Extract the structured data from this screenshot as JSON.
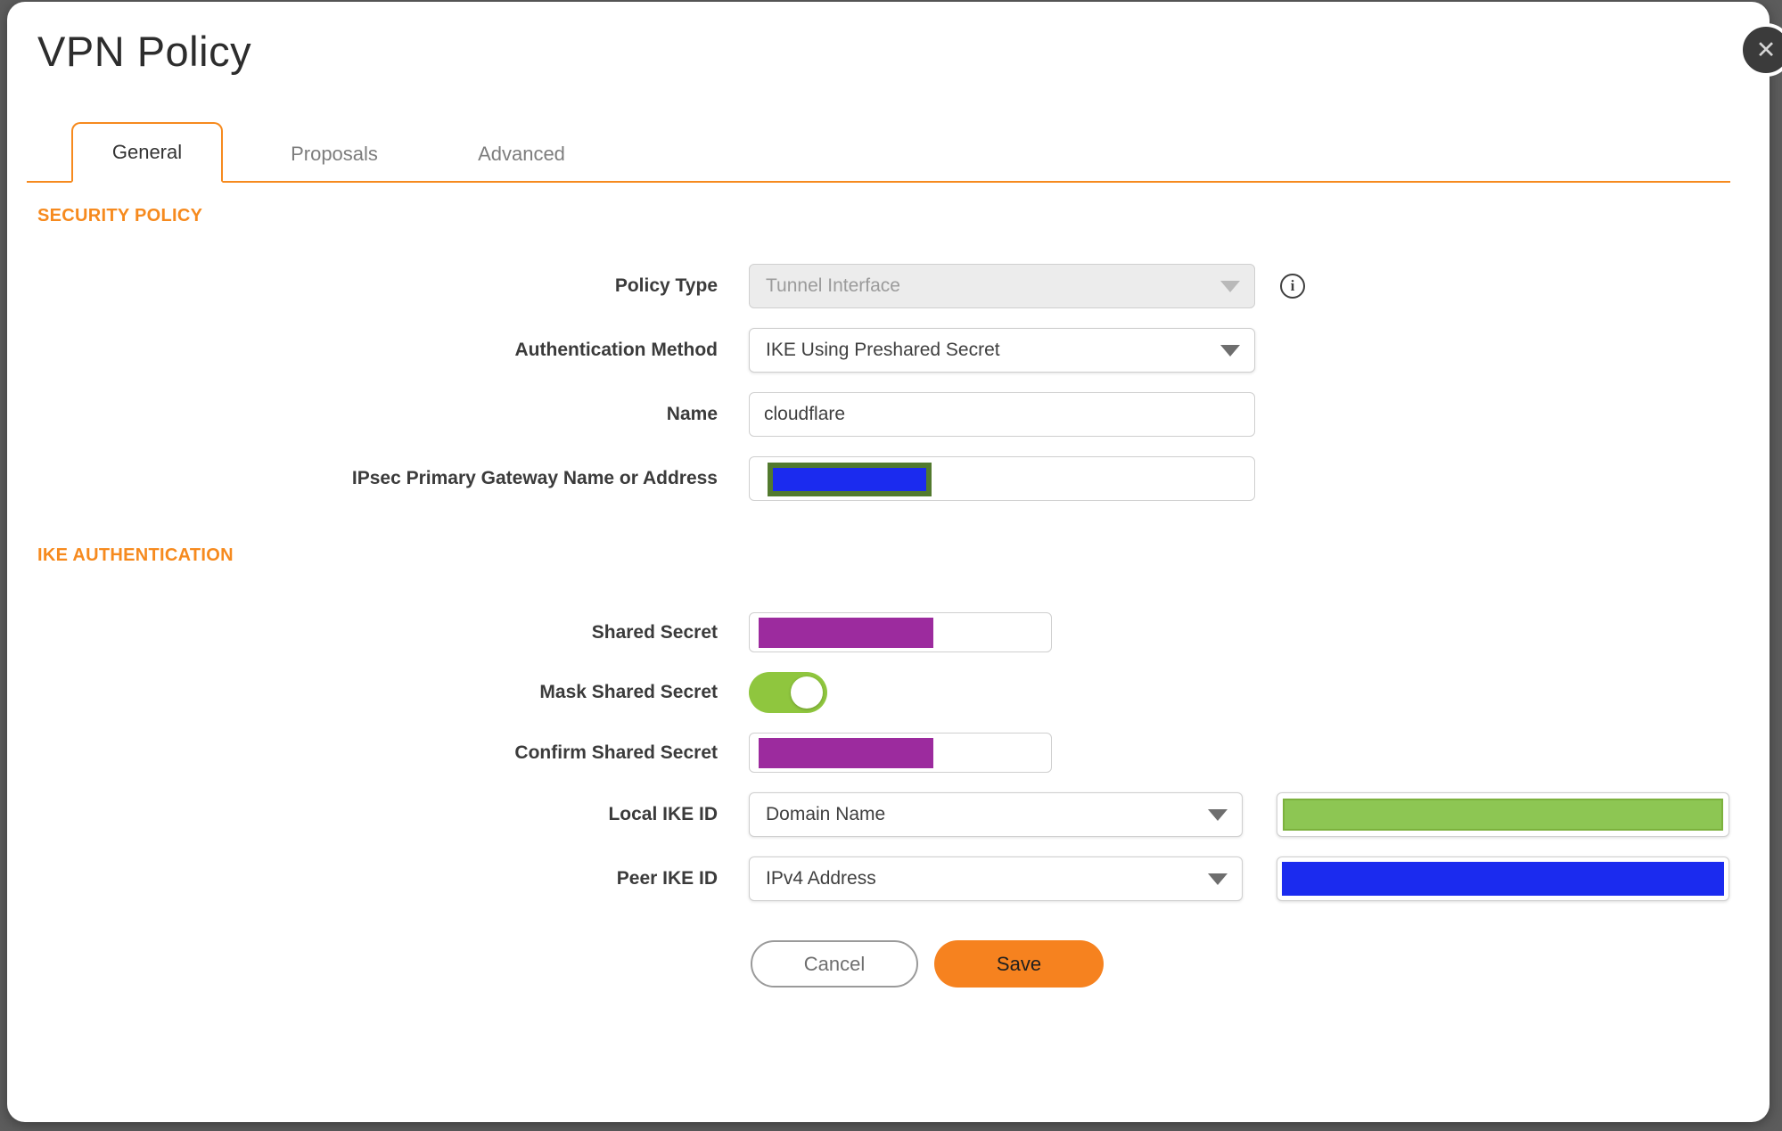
{
  "colors": {
    "accent_orange": "#f68a1e",
    "save_orange": "#f6821f",
    "backdrop_gray": "#5c5c5c",
    "redaction_purple": "#9c2b9e",
    "redaction_blue": "#1b2bef",
    "redaction_blue_border": "#527a2e",
    "redaction_green": "#8dc653",
    "redaction_green_border": "#7cb13d",
    "toggle_green": "#8fc63e"
  },
  "icons": {
    "close": "✕",
    "info": "i",
    "caret_down": "▼"
  },
  "dialog": {
    "title": "VPN Policy"
  },
  "tabs": [
    {
      "label": "General",
      "active": true
    },
    {
      "label": "Proposals",
      "active": false
    },
    {
      "label": "Advanced",
      "active": false
    }
  ],
  "security_policy": {
    "heading": "SECURITY POLICY",
    "policy_type_label": "Policy Type",
    "policy_type_value": "Tunnel Interface",
    "auth_method_label": "Authentication Method",
    "auth_method_value": "IKE Using Preshared Secret",
    "name_label": "Name",
    "name_value": "cloudflare",
    "gateway_label": "IPsec Primary Gateway Name or Address"
  },
  "ike_authentication": {
    "heading": "IKE AUTHENTICATION",
    "shared_secret_label": "Shared Secret",
    "mask_shared_secret_label": "Mask Shared Secret",
    "mask_shared_secret_state": "on",
    "confirm_shared_secret_label": "Confirm Shared Secret",
    "local_ike_id_label": "Local IKE ID",
    "local_ike_id_type": "Domain Name",
    "peer_ike_id_label": "Peer IKE ID",
    "peer_ike_id_type": "IPv4 Address"
  },
  "actions": {
    "cancel": "Cancel",
    "save": "Save"
  }
}
